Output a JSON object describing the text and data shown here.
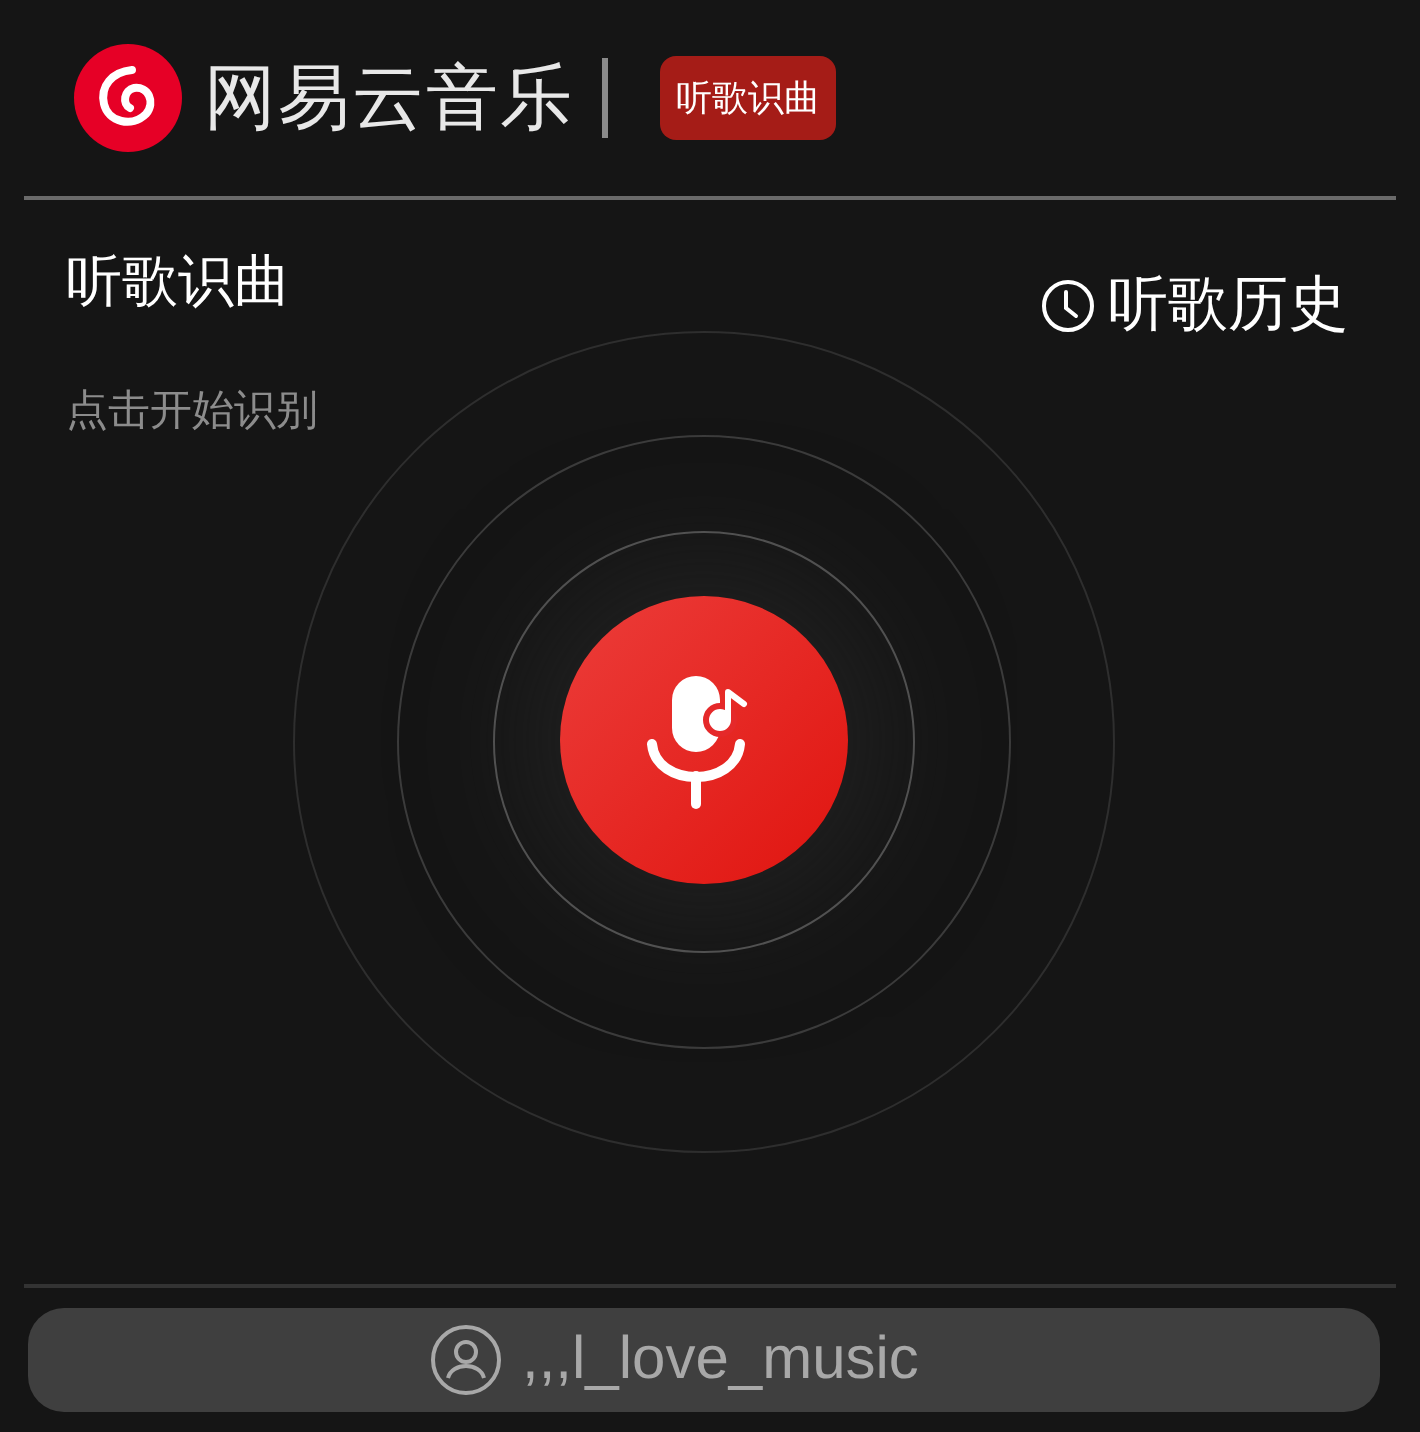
{
  "header": {
    "brand": "网易云音乐",
    "badge": "听歌识曲"
  },
  "page": {
    "title": "听歌识曲",
    "subtitle": "点击开始识别",
    "history": "听歌历史"
  },
  "bottom_bar": {
    "user": ",,,l_love_music"
  }
}
